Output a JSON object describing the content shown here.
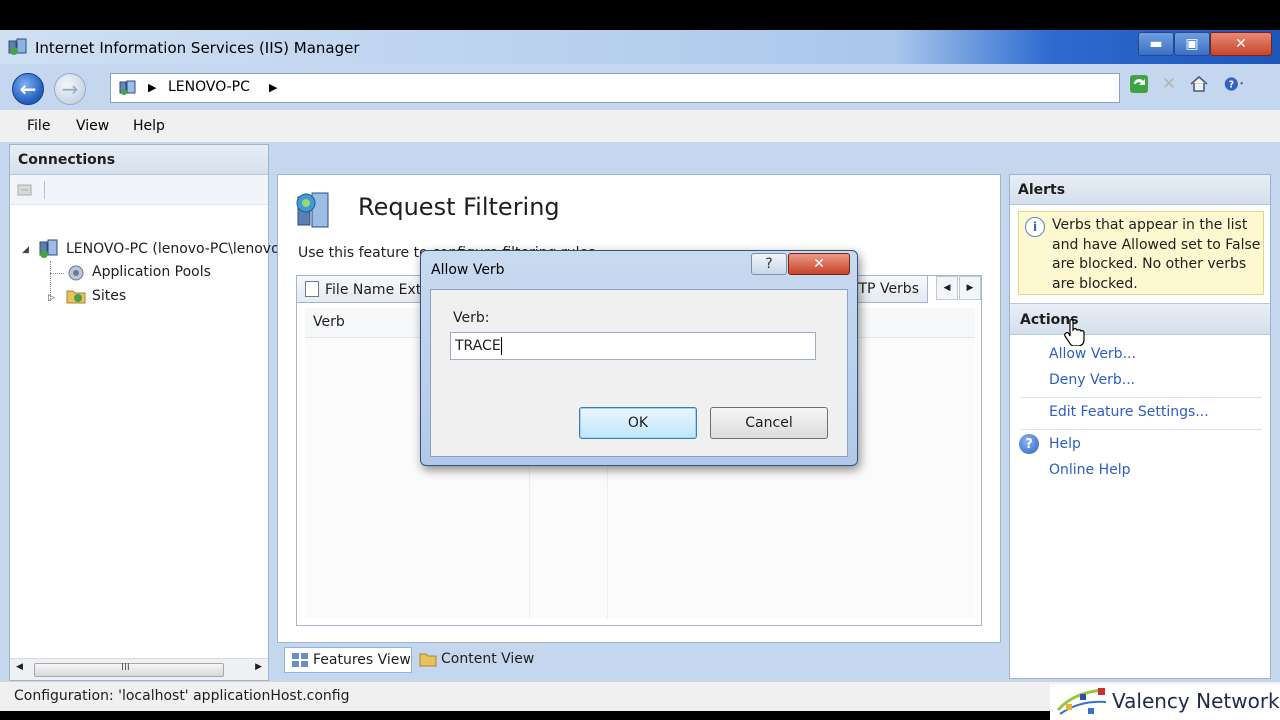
{
  "window": {
    "title": "Internet Information Services (IIS) Manager",
    "min_glyph": "▬",
    "max_glyph": "▣",
    "close_glyph": "✕"
  },
  "address_bar": {
    "path": "LENOVO-PC"
  },
  "menu": {
    "file": "File",
    "view": "View",
    "help": "Help"
  },
  "connections": {
    "title": "Connections",
    "tree": [
      {
        "label": "LENOVO-PC (lenovo-PC\\lenovo)"
      },
      {
        "label": "Application Pools"
      },
      {
        "label": "Sites"
      }
    ],
    "scroll_glyph": "III"
  },
  "feature": {
    "title": "Request Filtering",
    "description": "Use this feature to configure filtering rules.",
    "tabs": {
      "first": "File Name Extensions",
      "last": "HTTP Verbs"
    },
    "column_header": "Verb"
  },
  "views": {
    "features": "Features View",
    "content": "Content View"
  },
  "alerts": {
    "title": "Alerts",
    "message": "Verbs that appear in the list and have Allowed set to False are blocked. No other verbs are blocked."
  },
  "actions": {
    "title": "Actions",
    "allow_verb": "Allow Verb...",
    "deny_verb": "Deny Verb...",
    "edit_feature_settings": "Edit Feature Settings...",
    "help": "Help",
    "online_help": "Online Help"
  },
  "status_bar": {
    "text": "Configuration: 'localhost' applicationHost.config"
  },
  "dialog": {
    "title": "Allow Verb",
    "help_glyph": "?",
    "close_glyph": "✕",
    "verb_label": "Verb:",
    "verb_value": "TRACE",
    "ok_label": "OK",
    "cancel_label": "Cancel"
  },
  "watermark": {
    "text": "Valency Networks"
  },
  "colors": {
    "link": "#2c5ec0",
    "alert_bg": "#fdf8d0",
    "title_accent": "#1d56b8"
  }
}
